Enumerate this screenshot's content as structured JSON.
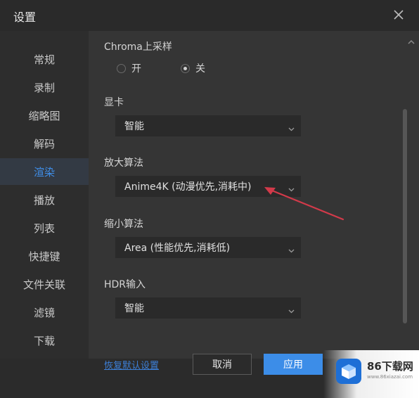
{
  "window": {
    "title": "设置",
    "close_icon": "close-icon"
  },
  "sidebar": {
    "items": [
      {
        "label": "常规",
        "active": false
      },
      {
        "label": "录制",
        "active": false
      },
      {
        "label": "缩略图",
        "active": false
      },
      {
        "label": "解码",
        "active": false
      },
      {
        "label": "渲染",
        "active": true
      },
      {
        "label": "播放",
        "active": false
      },
      {
        "label": "列表",
        "active": false
      },
      {
        "label": "快捷键",
        "active": false
      },
      {
        "label": "文件关联",
        "active": false
      },
      {
        "label": "滤镜",
        "active": false
      },
      {
        "label": "下载",
        "active": false
      }
    ]
  },
  "chroma": {
    "label": "Chroma上采样",
    "options": [
      {
        "label": "开",
        "selected": false
      },
      {
        "label": "关",
        "selected": true
      }
    ]
  },
  "gpu": {
    "label": "显卡",
    "value": "智能"
  },
  "upscale": {
    "label": "放大算法",
    "value": "Anime4K (动漫优先,消耗中)"
  },
  "downscale": {
    "label": "缩小算法",
    "value": "Area (性能优先,消耗低)"
  },
  "hdr": {
    "label": "HDR输入",
    "value": "智能"
  },
  "footer": {
    "restore_label": "恢复默认设置",
    "cancel_label": "取消",
    "apply_label": "应用"
  },
  "watermark": {
    "brand": "86下载网",
    "url": "www.86xiazai.com"
  },
  "colors": {
    "accent": "#3c8de8",
    "annotation_arrow": "#d23a4a"
  }
}
